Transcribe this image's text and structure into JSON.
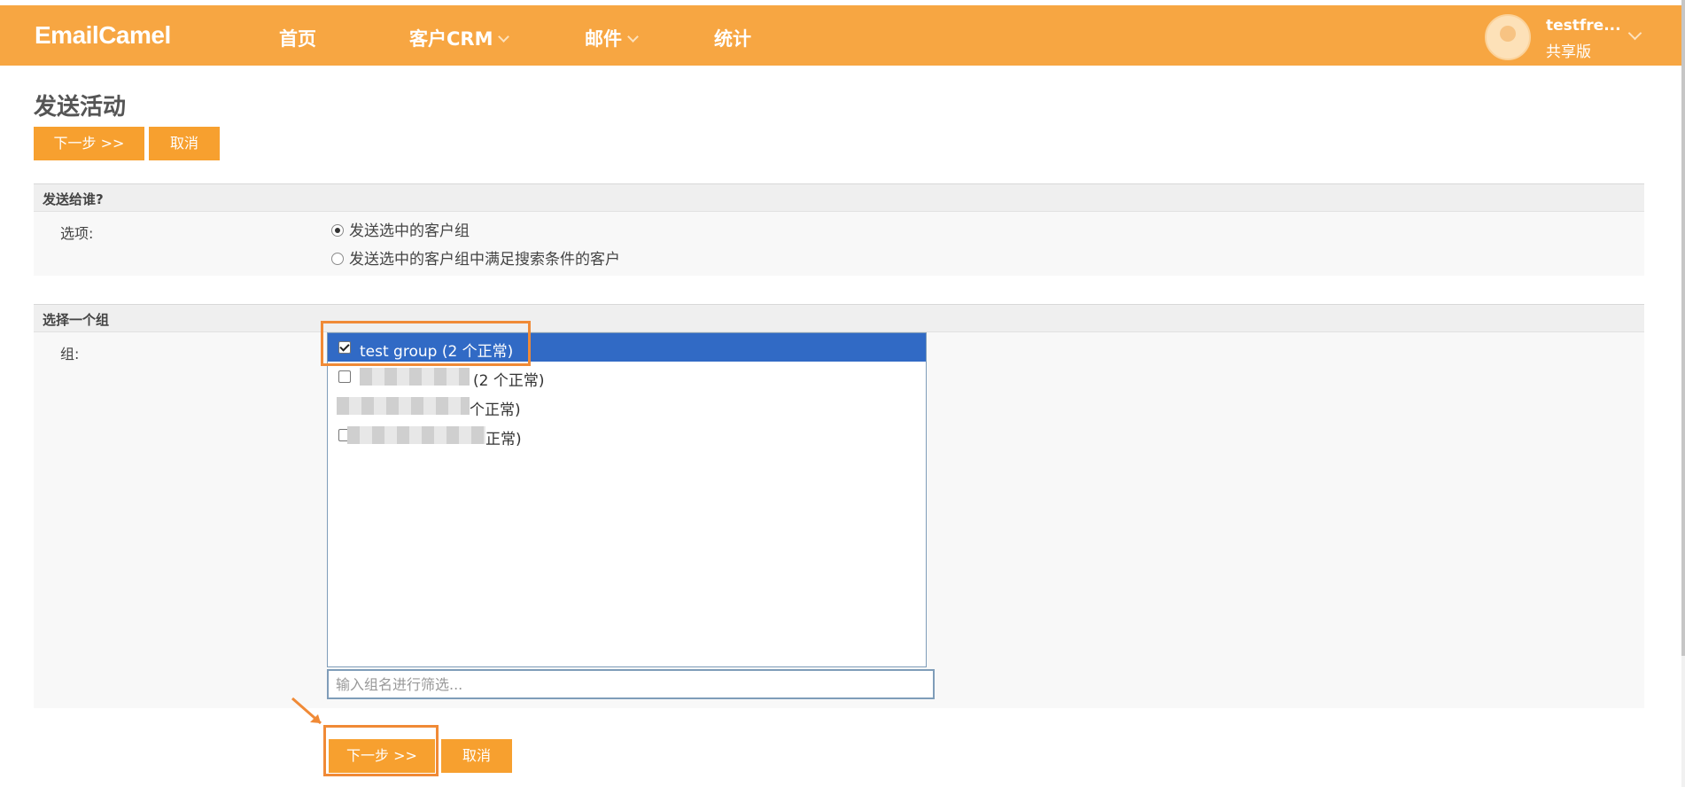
{
  "header": {
    "brand": "EmailCamel",
    "nav": [
      {
        "label": "首页",
        "has_dropdown": false
      },
      {
        "label": "客户CRM",
        "has_dropdown": true
      },
      {
        "label": "邮件",
        "has_dropdown": true
      },
      {
        "label": "统计",
        "has_dropdown": false
      }
    ],
    "user": {
      "name": "testfre...",
      "plan": "共享版"
    }
  },
  "page": {
    "title": "发送活动",
    "next_label": "下一步 >>",
    "cancel_label": "取消"
  },
  "recipients_section": {
    "title": "发送给谁?",
    "label": "选项:",
    "options": [
      {
        "label": "发送选中的客户组",
        "checked": true
      },
      {
        "label": "发送选中的客户组中满足搜索条件的客户",
        "checked": false
      }
    ]
  },
  "group_section": {
    "title": "选择一个组",
    "label": "组:",
    "groups": [
      {
        "label": "test group (2 个正常)",
        "checked": true,
        "selected": true
      },
      {
        "label": "(2 个正常)",
        "checked": false,
        "selected": false,
        "redacted": true
      },
      {
        "label": "个正常)",
        "checked": false,
        "selected": false,
        "redacted": true
      },
      {
        "label": "正常)",
        "checked": false,
        "selected": false,
        "redacted": true
      }
    ],
    "filter_placeholder": "输入组名进行筛选..."
  },
  "colors": {
    "header_bg": "#f7a642",
    "button_bg": "#f7a02f",
    "selected_row": "#316ac5",
    "highlight": "#f08a36"
  }
}
